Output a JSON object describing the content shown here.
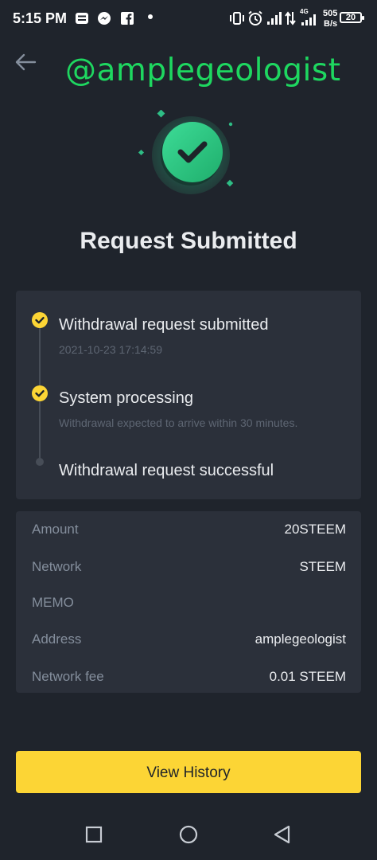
{
  "status_bar": {
    "time": "5:15 PM",
    "net_speed_top": "505",
    "net_speed_bottom": "B/s",
    "network_type": "4G",
    "battery": "20"
  },
  "watermark": "@amplegeologist",
  "title": "Request Submitted",
  "steps": [
    {
      "title": "Withdrawal request submitted",
      "subtitle": "2021-10-23 17:14:59",
      "status": "done"
    },
    {
      "title": "System processing",
      "subtitle": "Withdrawal expected to arrive within 30 minutes.",
      "status": "done"
    },
    {
      "title": "Withdrawal request successful",
      "subtitle": "",
      "status": "pending"
    }
  ],
  "details": [
    {
      "label": "Amount",
      "value": "20STEEM"
    },
    {
      "label": "Network",
      "value": "STEEM"
    },
    {
      "label": "MEMO",
      "value": ""
    },
    {
      "label": "Address",
      "value": "amplegeologist"
    },
    {
      "label": "Network fee",
      "value": "0.01 STEEM"
    }
  ],
  "button": {
    "label": "View History"
  },
  "colors": {
    "background": "#1f242c",
    "card": "#2b303a",
    "accent_yellow": "#fcd535",
    "success_green": "#2ebd85",
    "watermark_green": "#1ed760"
  },
  "icons": {
    "back": "arrow-left-icon",
    "hero": "check-circle-icon",
    "step_done": "check-badge-icon",
    "nav_recents": "square-icon",
    "nav_home": "circle-icon",
    "nav_back": "triangle-left-icon"
  }
}
